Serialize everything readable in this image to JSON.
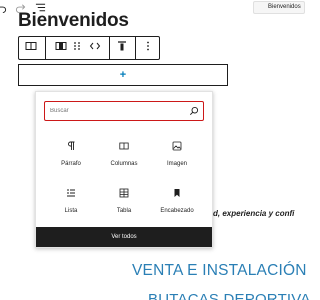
{
  "topbar": {
    "undo_icon": "undo-icon",
    "redo_icon": "redo-icon",
    "outline_icon": "document-outline-icon",
    "page_label": "Bienvenidos"
  },
  "page": {
    "title": "Bienvenidos"
  },
  "block_toolbar": {
    "buttons": [
      {
        "icon": "columns-block-icon"
      },
      {
        "icon": "column-block-icon"
      },
      {
        "icon": "drag-handle-icon"
      },
      {
        "icon": "move-arrows-icon"
      },
      {
        "icon": "vertical-align-top-icon"
      },
      {
        "icon": "more-options-icon"
      }
    ]
  },
  "appender": {
    "label": "+"
  },
  "inserter": {
    "search_placeholder": "Buscar",
    "blocks": [
      {
        "label": "Párrafo",
        "icon": "paragraph-icon"
      },
      {
        "label": "Columnas",
        "icon": "columns-icon"
      },
      {
        "label": "Imagen",
        "icon": "image-icon"
      },
      {
        "label": "Lista",
        "icon": "list-icon"
      },
      {
        "label": "Tabla",
        "icon": "table-icon"
      },
      {
        "label": "Encabezado",
        "icon": "bookmark-icon"
      }
    ],
    "view_all_label": "Ver todos"
  },
  "background": {
    "tagline": "d, experiencia y confi",
    "heading1": "VENTA E INSTALACIÓN",
    "heading2": "BUTACAS DEPORTIVA"
  },
  "colors": {
    "accent": "#007cba",
    "search_border": "#cc1818",
    "heading_blue": "#2a7fb5",
    "dark": "#1e1e1e"
  }
}
